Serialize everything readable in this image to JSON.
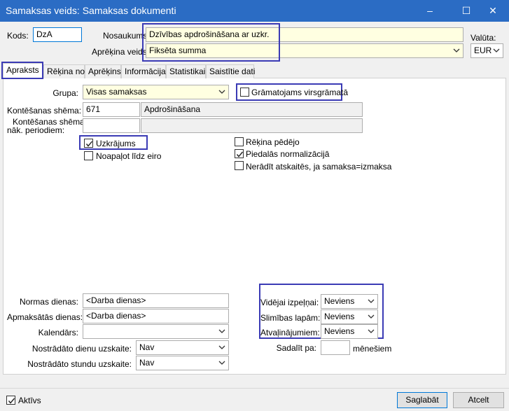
{
  "window": {
    "title": "Samaksas veids: Samaksas dokumenti",
    "controls": {
      "minimize": "–",
      "maximize": "☐",
      "close": "✕"
    }
  },
  "header": {
    "kods_label": "Kods:",
    "kods_value": "DzA",
    "nosaukums_label": "Nosaukums",
    "nosaukums_value": "Dzīvības apdrošināšana ar uzkr.",
    "aprekina_veids_label": "Aprēķina veids",
    "aprekina_veids_value": "Fiksēta summa",
    "valuta_label": "Valūta:",
    "valuta_value": "EUR"
  },
  "tabs": [
    {
      "label": "Apraksts"
    },
    {
      "label": "Rēķina no"
    },
    {
      "label": "Aprēķins"
    },
    {
      "label": "Informācija"
    },
    {
      "label": "Statistikai"
    },
    {
      "label": "Saistītie dati"
    }
  ],
  "form": {
    "grupa_label": "Grupa:",
    "grupa_value": "Visas samaksas",
    "gramatojams_label": "Grāmatojams virsgrāmatā",
    "gramatojams_checked": false,
    "kontesanas_label": "Kontēšanas shēma:",
    "kontesanas_code": "671",
    "kontesanas_name": "Apdrošināšana",
    "kontesanas_nak_label_1": "Kontēšanas shēma",
    "kontesanas_nak_label_2": "nāk. periodiem:",
    "kontesanas_nak_code": "",
    "kontesanas_nak_name": "",
    "uzkrajums_label": "Uzkrājums",
    "uzkrajums_checked": true,
    "noapalot_label": "Noapaļot līdz eiro",
    "noapalot_checked": false,
    "rekina_pedejo_label": "Rēķina pēdējo",
    "rekina_pedejo_checked": false,
    "piedalas_label": "Piedalās normalizācijā",
    "piedalas_checked": true,
    "neradit_label": "Nerādīt atskaitēs, ja samaksa=izmaksa",
    "neradit_checked": false,
    "normas_dienas_label": "Normas dienas:",
    "normas_dienas_value": "<Darba dienas>",
    "apmaksatas_dienas_label": "Apmaksātās dienas:",
    "apmaksatas_dienas_value": "<Darba dienas>",
    "kalendars_label": "Kalendārs:",
    "kalendars_value": "",
    "nostradato_dienu_label": "Nostrādāto dienu uzskaite:",
    "nostradato_dienu_value": "Nav",
    "nostradato_stundu_label": "Nostrādāto stundu uzskaite:",
    "nostradato_stundu_value": "Nav",
    "videjai_label": "Vidējai izpeļņai:",
    "videjai_value": "Neviens",
    "slimibas_label": "Slimības lapām:",
    "slimibas_value": "Neviens",
    "atvalinajumiem_label": "Atvaļinājumiem:",
    "atvalinajumiem_value": "Neviens",
    "sadalit_label": "Sadalīt pa:",
    "sadalit_value": "",
    "menesiem_label": "mēnešiem"
  },
  "footer": {
    "aktivs_label": "Aktīvs",
    "aktivs_checked": true,
    "save_label": "Saglabāt",
    "cancel_label": "Atcelt"
  },
  "colors": {
    "titlebar": "#2b6cc4",
    "highlight_box": "#3b3bb5",
    "required_field": "#ffffe1"
  }
}
